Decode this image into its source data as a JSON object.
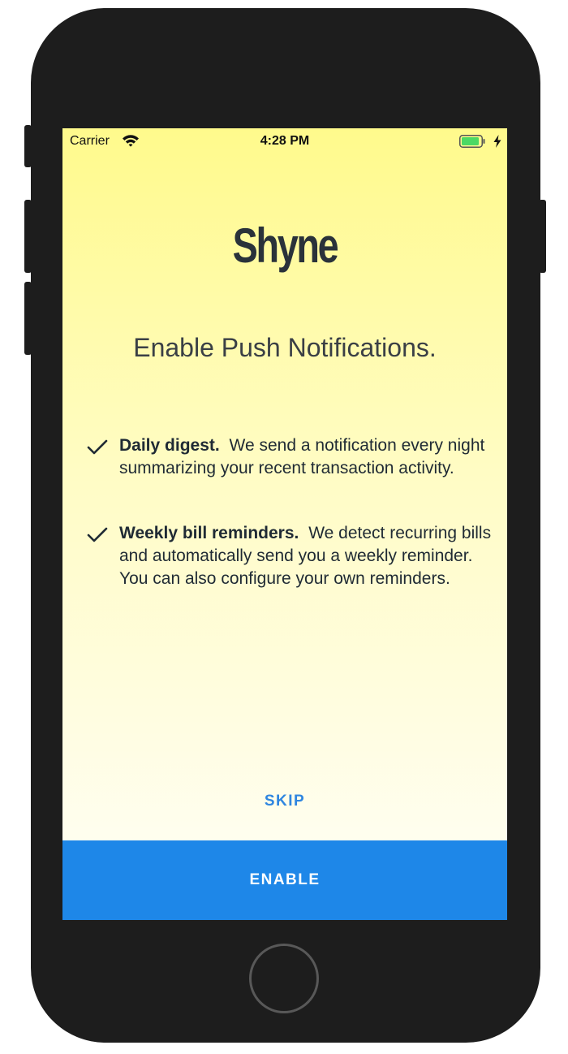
{
  "status_bar": {
    "carrier": "Carrier",
    "time": "4:28 PM",
    "wifi_icon": "wifi-icon",
    "battery_icon": "battery-icon",
    "charging_icon": "bolt-icon"
  },
  "logo": {
    "text": "Shyne"
  },
  "heading": "Enable Push Notifications.",
  "features": [
    {
      "icon": "checkmark-icon",
      "title": "Daily digest.",
      "body": "We send a notification every night summarizing your recent transaction activity."
    },
    {
      "icon": "checkmark-icon",
      "title": "Weekly bill reminders.",
      "body": "We detect recurring bills and automatically send you a weekly reminder. You can also configure your own reminders."
    }
  ],
  "buttons": {
    "skip_label": "SKIP",
    "enable_label": "ENABLE"
  },
  "colors": {
    "accent": "#1e87e8",
    "link": "#2f86e0",
    "background_top": "#fffa8c",
    "background_bottom": "#fffef8",
    "text": "#1f2a34",
    "device": "#1d1d1d"
  }
}
